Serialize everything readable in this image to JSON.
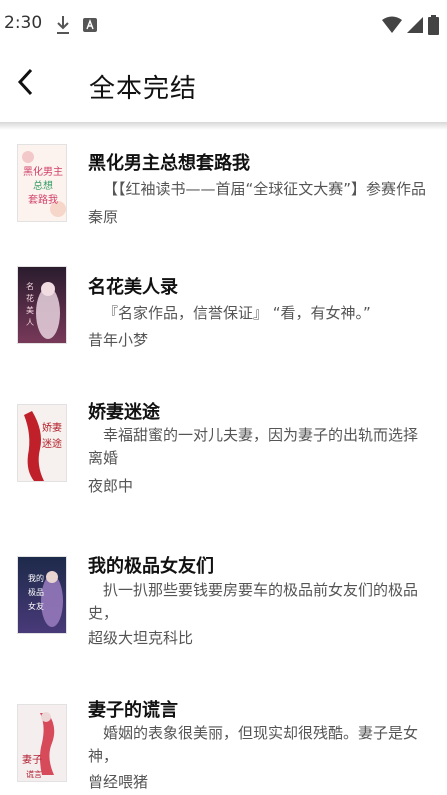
{
  "status_bar": {
    "time": "2:30",
    "icons": [
      "download-icon",
      "a-notification-icon",
      "wifi-icon",
      "signal-icon",
      "battery-icon"
    ]
  },
  "header": {
    "title": "全本完结",
    "back_icon": "back-arrow-icon"
  },
  "books": [
    {
      "title": "黑化男主总想套路我",
      "desc": "【【红袖读书——首届“全球征文大赛”】参赛作品",
      "author": "秦原",
      "cover_text": "黑化男主总想套路我"
    },
    {
      "title": "名花美人录",
      "desc": "『名家作品，信誉保证』 “看，有女神。”",
      "author": "昔年小梦",
      "cover_text": "名花美人录"
    },
    {
      "title": "娇妻迷途",
      "desc": "幸福甜蜜的一对儿夫妻，因为妻子的出轨而选择离婚",
      "author": "夜郎中",
      "cover_text": "娇妻迷途"
    },
    {
      "title": "我的极品女友们",
      "desc": "扒一扒那些要钱要房要车的极品前女友们的极品史，",
      "author": "超级大坦克科比",
      "cover_text": "我的极品女友们"
    },
    {
      "title": "妻子的谎言",
      "desc": "婚姻的表象很美丽，但现实却很残酷。妻子是女神，",
      "author": "曾经喂猪",
      "cover_text": "妻子的谎言"
    }
  ]
}
